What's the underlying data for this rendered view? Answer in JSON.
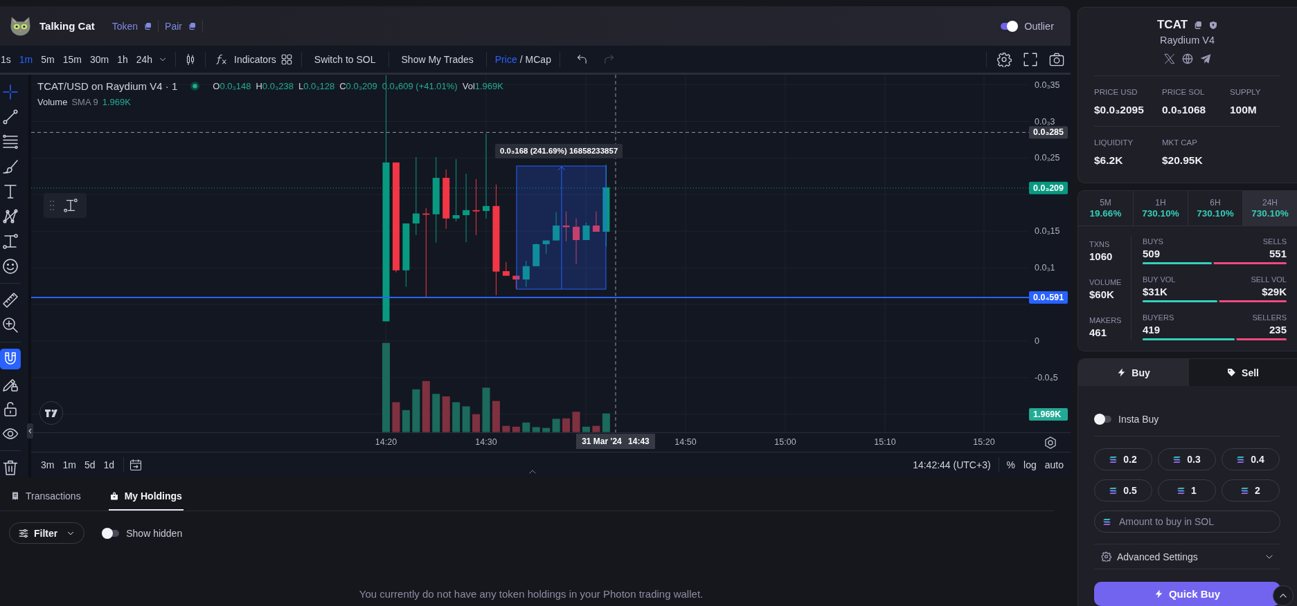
{
  "header": {
    "title": "Talking Cat",
    "links": [
      {
        "label": "Token"
      },
      {
        "label": "Pair"
      }
    ],
    "outlier": {
      "label": "Outlier",
      "on": true
    }
  },
  "toolbar": {
    "intervals": [
      {
        "label": "1s",
        "selected": false
      },
      {
        "label": "1m",
        "selected": true
      },
      {
        "label": "5m",
        "selected": false
      },
      {
        "label": "15m",
        "selected": false
      },
      {
        "label": "30m",
        "selected": false
      },
      {
        "label": "1h",
        "selected": false
      },
      {
        "label": "24h",
        "selected": false
      }
    ],
    "indicators": "Indicators",
    "actions": [
      {
        "label": "Switch to SOL"
      },
      {
        "label": "Show My Trades"
      }
    ],
    "display": [
      {
        "label": "Price",
        "selected": true
      },
      {
        "label": "MCap",
        "selected": false
      }
    ],
    "display_separator": "/",
    "history": [
      {
        "kind": "undo",
        "disabled": false
      },
      {
        "kind": "redo",
        "disabled": true
      }
    ]
  },
  "chart": {
    "legend": {
      "title": "TCAT/USD on Raydium V4 · 1",
      "ohlc": [
        {
          "key": "O",
          "value": "0.0₃148"
        },
        {
          "key": "H",
          "value": "0.0₃238"
        },
        {
          "key": "L",
          "value": "0.0₃128"
        },
        {
          "key": "C",
          "value": "0.0₃209"
        }
      ],
      "change": "0.0₄609 (+41.01%)",
      "volume": {
        "key": "Vol",
        "value": "1.969K"
      },
      "study": {
        "name": "Volume",
        "params": "SMA 9",
        "value": "1.969K"
      }
    },
    "measure_label": "0.0₃168 (241.69%) 16858233857",
    "drawing_tools": [
      {
        "kind": "crosshair",
        "selected": true
      },
      {
        "kind": "trend-line",
        "selected": false
      },
      {
        "kind": "parallel-lines",
        "selected": false
      },
      {
        "kind": "brush",
        "selected": false
      },
      {
        "kind": "text",
        "selected": false
      },
      {
        "kind": "pattern",
        "selected": false
      },
      {
        "kind": "projection",
        "selected": false
      },
      {
        "kind": "emoji",
        "selected": false
      }
    ],
    "measure_tools": [
      {
        "kind": "ruler"
      },
      {
        "kind": "zoom"
      }
    ],
    "toggle_tools": [
      {
        "kind": "magnet",
        "on": true
      },
      {
        "kind": "drawing-lock",
        "on": false
      },
      {
        "kind": "lock",
        "on": false
      },
      {
        "kind": "eye",
        "on": false
      }
    ],
    "price_axis": {
      "ticks": [
        "0.0₃35",
        "0.0₃3",
        "0.0₃25",
        "0.0₃15",
        "0.0₃1",
        "0",
        "-0.0₄5"
      ],
      "badges": [
        {
          "kind": "crosshair",
          "label": "0.0₃285"
        },
        {
          "kind": "last",
          "label": "0.0₃209"
        },
        {
          "kind": "line",
          "label": "0.0₄591"
        },
        {
          "kind": "volume",
          "label": "1.969K"
        }
      ]
    },
    "time_axis": {
      "ticks": [
        "14:20",
        "14:30",
        "14:50",
        "15:00",
        "15:10",
        "15:20"
      ],
      "crosshair": {
        "date": "31 Mar '24",
        "time": "14:43"
      }
    },
    "ranges": [
      "3m",
      "1m",
      "5d",
      "1d"
    ],
    "clock": "14:42:44 (UTC+3)",
    "scale_options": [
      "%",
      "log",
      "auto"
    ]
  },
  "holdings": {
    "tabs": [
      {
        "label": "Transactions",
        "kind": "transactions",
        "selected": false
      },
      {
        "label": "My Holdings",
        "kind": "holdings",
        "selected": true
      }
    ],
    "filter": "Filter",
    "show_hidden": {
      "label": "Show hidden",
      "on": false
    },
    "empty_message": "You currently do not have any token holdings in your Photon trading wallet."
  },
  "token": {
    "symbol": "TCAT",
    "dex": "Raydium V4",
    "stat_rows": [
      [
        {
          "label": "PRICE USD",
          "value": "$0.0₃2095"
        },
        {
          "label": "PRICE SOL",
          "value": "0.0₅1068"
        },
        {
          "label": "SUPPLY",
          "value": "100M"
        }
      ],
      [
        {
          "label": "LIQUIDITY",
          "value": "$6.2K"
        },
        {
          "label": "MKT CAP",
          "value": "$20.95K"
        }
      ]
    ]
  },
  "periods": [
    {
      "label": "5M",
      "value": "19.66%",
      "selected": false
    },
    {
      "label": "1H",
      "value": "730.10%",
      "selected": false
    },
    {
      "label": "6H",
      "value": "730.10%",
      "selected": false
    },
    {
      "label": "24H",
      "value": "730.10%",
      "selected": true
    }
  ],
  "activity": {
    "totals": [
      {
        "label": "TXNS",
        "value": "1060"
      },
      {
        "label": "VOLUME",
        "value": "$60K"
      },
      {
        "label": "MAKERS",
        "value": "461"
      }
    ],
    "splits": [
      {
        "buy_label": "BUYS",
        "buy_value": "509",
        "sell_label": "SELLS",
        "sell_value": "551",
        "level": 0.48
      },
      {
        "buy_label": "BUY VOL",
        "buy_value": "$31K",
        "sell_label": "SELL VOL",
        "sell_value": "$29K",
        "level": 0.52
      },
      {
        "buy_label": "BUYERS",
        "buy_value": "419",
        "sell_label": "SELLERS",
        "sell_value": "235",
        "level": 0.64
      }
    ]
  },
  "trade": {
    "tabs": [
      {
        "label": "Buy",
        "kind": "buy",
        "selected": true
      },
      {
        "label": "Sell",
        "kind": "sell",
        "selected": false
      }
    ],
    "insta_buy": {
      "label": "Insta Buy",
      "on": false
    },
    "amounts": [
      "0.2",
      "0.3",
      "0.4",
      "0.5",
      "1",
      "2"
    ],
    "amount_field": {
      "placeholder": "Amount to buy in SOL"
    },
    "advanced": {
      "label": "Advanced Settings",
      "expanded": false
    },
    "submit": "Quick Buy"
  }
}
